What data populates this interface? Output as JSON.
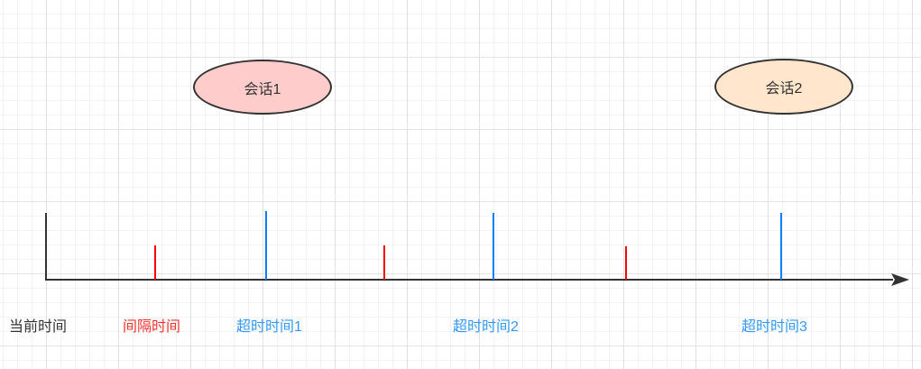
{
  "sessions": [
    {
      "label": "会话1",
      "fill": "#ffcccc"
    },
    {
      "label": "会话2",
      "fill": "#ffe6cc"
    }
  ],
  "labels": {
    "current_time": "当前时间",
    "interval_time": "间隔时间",
    "timeout_1": "超时时间1",
    "timeout_2": "超时时间2",
    "timeout_3": "超时时间3"
  },
  "colors": {
    "axis": "#333333",
    "interval_marker": "#ff0000",
    "timeout_marker": "#007fff",
    "interval_text": "#ff3333",
    "timeout_text": "#3399ff",
    "grid": "#e3e3e3"
  }
}
